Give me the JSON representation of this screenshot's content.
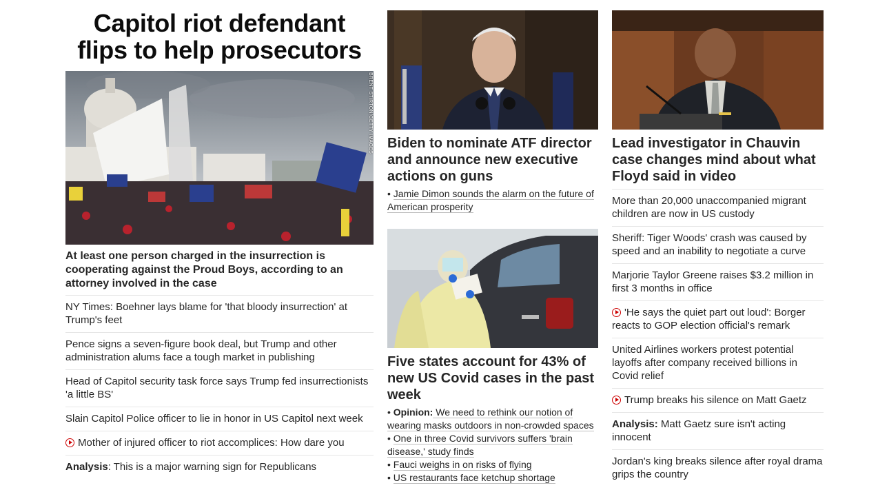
{
  "col1": {
    "headline": "Capitol riot defendant flips to help prosecutors",
    "photo_credit": "BRENT STIRTON/GETTY IMAGES",
    "lead": "At least one person charged in the insurrection is cooperating against the Proud Boys, according to an attorney involved in the case",
    "items": [
      {
        "text": "NY Times: Boehner lays blame for 'that bloody insurrection' at Trump's feet"
      },
      {
        "text": "Pence signs a seven-figure book deal, but Trump and other administration alums face a tough market in publishing"
      },
      {
        "text": "Head of Capitol security task force says Trump fed insurrectionists 'a little BS'"
      },
      {
        "text": "Slain Capitol Police officer to lie in honor in US Capitol next week"
      },
      {
        "text": "Mother of injured officer to riot accomplices: How dare you"
      },
      {
        "prefix": "Analysis",
        "text": ": This is a major warning sign for Republicans"
      }
    ]
  },
  "col2": {
    "story1": {
      "headline": "Biden to nominate ATF director and announce new executive actions on guns",
      "bullet": "Jamie Dimon sounds the alarm on the future of American prosperity"
    },
    "story2": {
      "headline": "Five states account for 43% of new US Covid cases in the past week",
      "bullets": [
        {
          "prefix": "Opinion:",
          "text": " We need to rethink our notion of wearing masks outdoors in non-crowded spaces"
        },
        {
          "text": "One in three Covid survivors suffers 'brain disease,' study finds"
        },
        {
          "text": "Fauci weighs in on risks of flying"
        },
        {
          "text": "US restaurants face ketchup shortage"
        }
      ]
    }
  },
  "col3": {
    "headline": "Lead investigator in Chauvin case changes mind about what Floyd said in video",
    "items": [
      {
        "text": "More than 20,000 unaccompanied migrant children are now in US custody"
      },
      {
        "text": "Sheriff: Tiger Woods' crash was caused by speed and an inability to negotiate a curve"
      },
      {
        "text": "Marjorie Taylor Greene raises $3.2 million in first 3 months in office"
      },
      {
        "text": "'He says the quiet part out loud': Borger reacts to GOP election official's remark"
      },
      {
        "text": "United Airlines workers protest potential layoffs after company received billions in Covid relief"
      },
      {
        "text": "Trump breaks his silence on Matt Gaetz"
      },
      {
        "prefix": "Analysis:",
        "text": " Matt Gaetz sure isn't acting innocent"
      },
      {
        "text": "Jordan's king breaks silence after royal drama grips the country"
      }
    ]
  },
  "colors": {
    "text": "#262626",
    "video_icon": "#cc0000",
    "divider": "#e6e6e6"
  }
}
